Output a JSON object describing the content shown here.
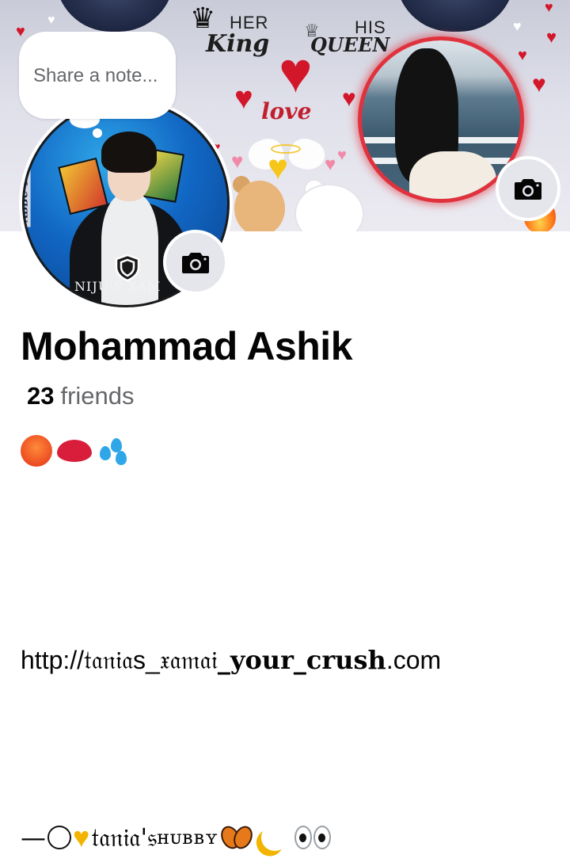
{
  "note": {
    "placeholder": "Share a note..."
  },
  "cover": {
    "her_label": "HER",
    "king_label": "King",
    "his_label": "HIS",
    "queen_label": "QUEEN",
    "love_label": "love"
  },
  "avatar": {
    "side_text": "ABBU TAH",
    "bottom_text": "NIJU'S XAM"
  },
  "profile": {
    "name": "Mohammad Ashik",
    "friends_count": "23",
    "friends_label": "friends"
  },
  "bio": {
    "emojis": [
      "hot-face-emoji",
      "kiss-mark-emoji",
      "sweat-droplets-emoji"
    ],
    "website_prefix": "http://",
    "website_styled": "𝔱𝔞𝔫𝔦𝔞",
    "website_mid": "s_",
    "website_styled2": "𝔵𝔞𝔪𝔞𝔦",
    "website_bold": "_your_crush",
    "website_suffix": ".com",
    "bottom_dash": "—",
    "bottom_styled": "𝔱𝔞𝔫𝔦𝔞'𝔰",
    "bottom_smallcaps": " ʜᴜʙʙʏ"
  },
  "colors": {
    "cover_ring": "#e0323d",
    "camera_button_bg": "#e4e6eb",
    "secondary_text": "#65676b",
    "primary_text": "#050505"
  }
}
